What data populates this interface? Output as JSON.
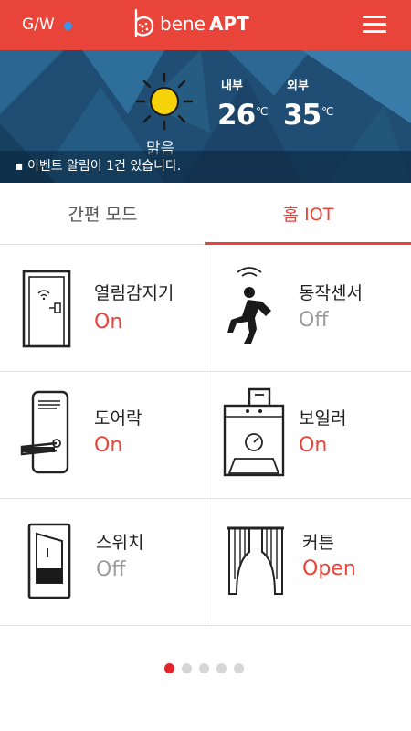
{
  "header": {
    "gw_label": "G/W",
    "logo_text_light": "bene",
    "logo_text_bold": "APT",
    "accent": "#e9443a",
    "status_dot_color": "#2f9bf4"
  },
  "weather": {
    "condition": "맑음",
    "inside_label": "내부",
    "inside_temp": "26",
    "inside_unit": "℃",
    "outside_label": "외부",
    "outside_temp": "35",
    "outside_unit": "℃",
    "notice": "▪ 이벤트 알림이 1건 있습니다."
  },
  "tabs": [
    {
      "label": "간편 모드",
      "active": false
    },
    {
      "label": "홈 IOT",
      "active": true
    }
  ],
  "devices": [
    {
      "name": "열림감지기",
      "status": "On",
      "icon": "door-sensor-icon"
    },
    {
      "name": "동작센서",
      "status": "Off",
      "icon": "motion-sensor-icon"
    },
    {
      "name": "도어락",
      "status": "On",
      "icon": "door-lock-icon"
    },
    {
      "name": "보일러",
      "status": "On",
      "icon": "boiler-icon"
    },
    {
      "name": "스위치",
      "status": "Off",
      "icon": "switch-icon"
    },
    {
      "name": "커튼",
      "status": "Open",
      "icon": "curtain-icon"
    }
  ],
  "pager": {
    "count": 5,
    "active_index": 0
  }
}
